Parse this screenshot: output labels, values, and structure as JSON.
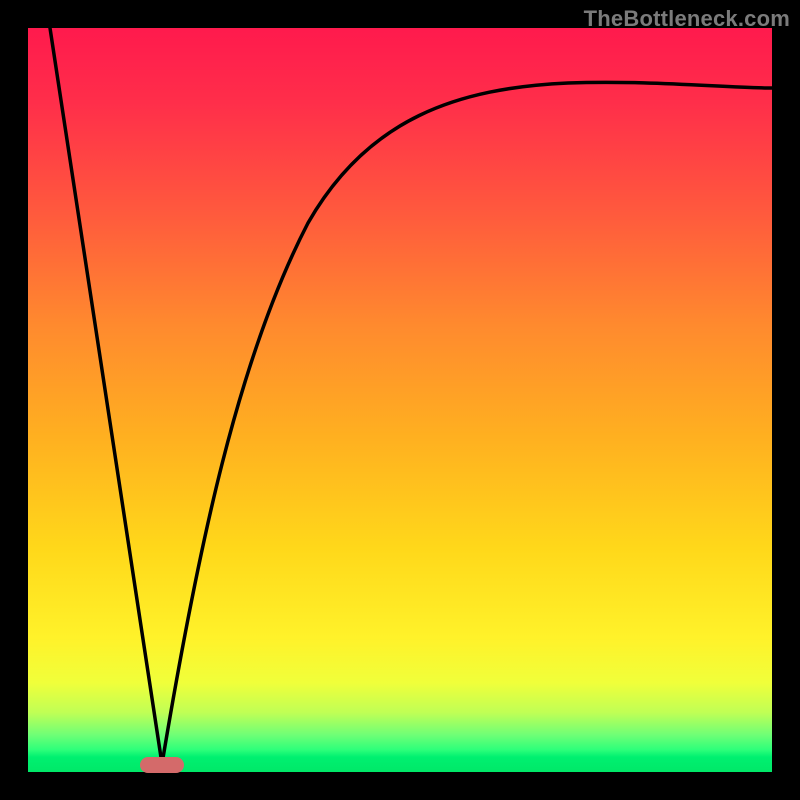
{
  "watermark": "TheBottleneck.com",
  "colors": {
    "frame": "#000000",
    "gradient_top": "#ff1a4d",
    "gradient_mid1": "#ff8a2e",
    "gradient_mid2": "#fff22a",
    "gradient_bottom": "#00e868",
    "curve": "#000000",
    "marker": "#d46a6a"
  },
  "chart_data": {
    "type": "line",
    "title": "",
    "xlabel": "",
    "ylabel": "",
    "xlim": [
      0,
      100
    ],
    "ylim": [
      0,
      100
    ],
    "series": [
      {
        "name": "left-slope",
        "x": [
          3,
          18
        ],
        "y": [
          100,
          1
        ]
      },
      {
        "name": "right-curve",
        "x": [
          18,
          22,
          26,
          30,
          35,
          40,
          48,
          58,
          70,
          85,
          100
        ],
        "y": [
          1,
          20,
          38,
          52,
          65,
          73,
          80,
          85,
          88,
          90,
          92
        ]
      }
    ],
    "marker": {
      "x": 18,
      "y": 1
    },
    "color_axis_note": "Background vertical gradient encodes value: top (red) = high bottleneck / mismatch, bottom (green) = optimal"
  }
}
